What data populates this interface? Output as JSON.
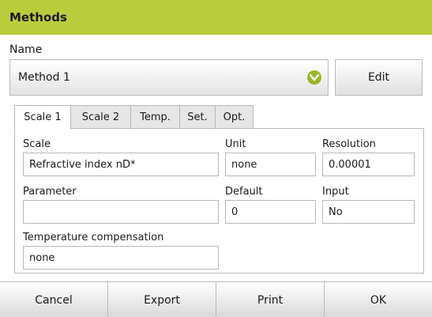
{
  "window": {
    "title": "Methods"
  },
  "name": {
    "label": "Name",
    "selected_method": "Method 1",
    "dropdown_icon": "chevron-down-icon",
    "edit_label": "Edit"
  },
  "tabs": [
    {
      "label": "Scale 1",
      "active": true
    },
    {
      "label": "Scale 2",
      "active": false
    },
    {
      "label": "Temp.",
      "active": false
    },
    {
      "label": "Set.",
      "active": false
    },
    {
      "label": "Opt.",
      "active": false
    }
  ],
  "form": {
    "scale": {
      "label": "Scale",
      "value": "Refractive index nD*"
    },
    "unit": {
      "label": "Unit",
      "value": "none"
    },
    "resolution": {
      "label": "Resolution",
      "value": "0.00001"
    },
    "parameter": {
      "label": "Parameter",
      "value": ""
    },
    "default": {
      "label": "Default",
      "value": "0"
    },
    "input": {
      "label": "Input",
      "value": "No"
    },
    "temp_comp": {
      "label": "Temperature compensation",
      "value": "none"
    }
  },
  "footer": {
    "cancel": "Cancel",
    "export": "Export",
    "print": "Print",
    "ok": "OK"
  },
  "colors": {
    "title_bar": "#b9cd3c",
    "accent_icon": "#9ab52a",
    "border": "#b8b8b8"
  }
}
